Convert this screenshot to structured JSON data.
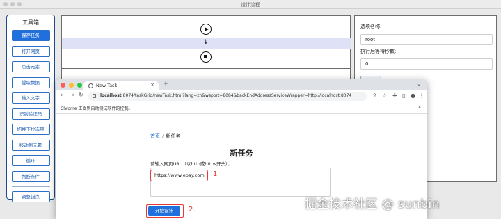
{
  "window": {
    "title": "设计流程"
  },
  "toolbox": {
    "title": "工具箱",
    "buttons": [
      "保存任务",
      "打开网页",
      "点击元素",
      "提取数据",
      "输入文字",
      "识别验证码",
      "切换下拉选项",
      "移动到元素",
      "循环",
      "判断条件"
    ],
    "bottom_button": "调整锚点",
    "accent": "#1f6fdc"
  },
  "props": {
    "option_name_label": "选项名称:",
    "option_name_value": "root",
    "wait_label": "执行后等待秒数:",
    "wait_value": "0"
  },
  "browser": {
    "tab_title": "New Task",
    "url_host": "localhost",
    "url_rest": ":8074/taskGrid/newTask.html?lang=zh&wsport=8084&backEndAddressServiceWrapper=http://localhost:8074",
    "infobar_text": "Chrome 正受到自动测试软件的控制。",
    "traffic_colors": [
      "#ff5f57",
      "#febc2e",
      "#28c840"
    ]
  },
  "page": {
    "breadcrumb_home": "首页",
    "breadcrumb_sep": "/",
    "breadcrumb_current": "新任务",
    "title": "新任务",
    "url_label": "请输入网页URL（以http或https开头）：",
    "url_value": "https://www.ebay.com",
    "start_button": "开始设计"
  },
  "annotations": {
    "mark1": "1",
    "mark2": "2.",
    "color": "#e53935"
  },
  "watermark": "掘金技术社区 @ sunbin"
}
